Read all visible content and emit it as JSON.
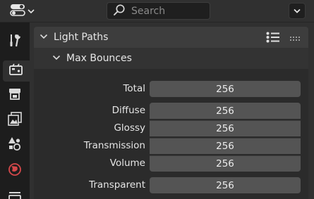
{
  "header": {
    "search_placeholder": "Search"
  },
  "tabs": [
    {
      "name": "tool-icon"
    },
    {
      "name": "render-icon",
      "active": true
    },
    {
      "name": "output-icon"
    },
    {
      "name": "view-layer-icon"
    },
    {
      "name": "scene-icon"
    },
    {
      "name": "world-icon"
    },
    {
      "name": "collection-icon"
    }
  ],
  "panel": {
    "title": "Light Paths",
    "subpanel_title": "Max Bounces",
    "fields": {
      "total": {
        "label": "Total",
        "value": "256"
      },
      "diffuse": {
        "label": "Diffuse",
        "value": "256"
      },
      "glossy": {
        "label": "Glossy",
        "value": "256"
      },
      "transmission": {
        "label": "Transmission",
        "value": "256"
      },
      "volume": {
        "label": "Volume",
        "value": "256"
      },
      "transparent": {
        "label": "Transparent",
        "value": "256"
      }
    }
  },
  "colors": {
    "panel_bg": "#2b2b2b",
    "field_bg": "#545454",
    "header_bg": "#3d3d3d"
  }
}
